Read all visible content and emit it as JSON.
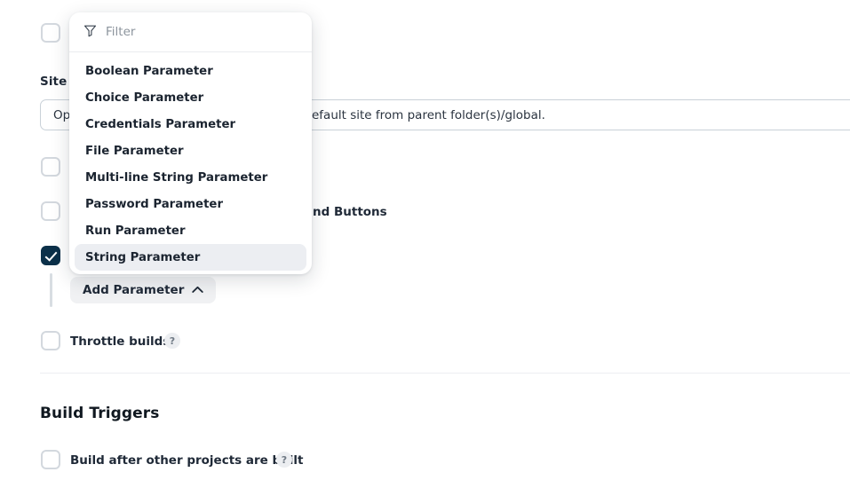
{
  "page": {
    "background_color": "#ffffff",
    "accent_color": "#0b3049"
  },
  "form": {
    "top_checkbox": {
      "checked": false
    },
    "site_field": {
      "label": "Site N",
      "value": "Opt",
      "description_tail": "efault site from parent folder(s)/global."
    },
    "options": [
      {
        "label": "",
        "checked": false
      },
      {
        "label": "nd Buttons",
        "checked": false
      }
    ],
    "parameters_option": {
      "label": "",
      "checked": true
    },
    "add_parameter": {
      "label": "Add Parameter",
      "icon": "chevron-up-icon",
      "expanded": true
    },
    "throttle": {
      "label": "Throttle builds",
      "checked": false,
      "help": "?"
    }
  },
  "build_triggers": {
    "heading": "Build Triggers",
    "items": [
      {
        "label": "Build after other projects are built",
        "checked": false,
        "help": "?"
      }
    ]
  },
  "dropdown": {
    "filter": {
      "placeholder": "Filter",
      "value": "",
      "icon": "filter-icon"
    },
    "items": [
      {
        "label": "Boolean Parameter",
        "active": false
      },
      {
        "label": "Choice Parameter",
        "active": false
      },
      {
        "label": "Credentials Parameter",
        "active": false
      },
      {
        "label": "File Parameter",
        "active": false
      },
      {
        "label": "Multi-line String Parameter",
        "active": false
      },
      {
        "label": "Password Parameter",
        "active": false
      },
      {
        "label": "Run Parameter",
        "active": false
      },
      {
        "label": "String Parameter",
        "active": true
      }
    ]
  }
}
